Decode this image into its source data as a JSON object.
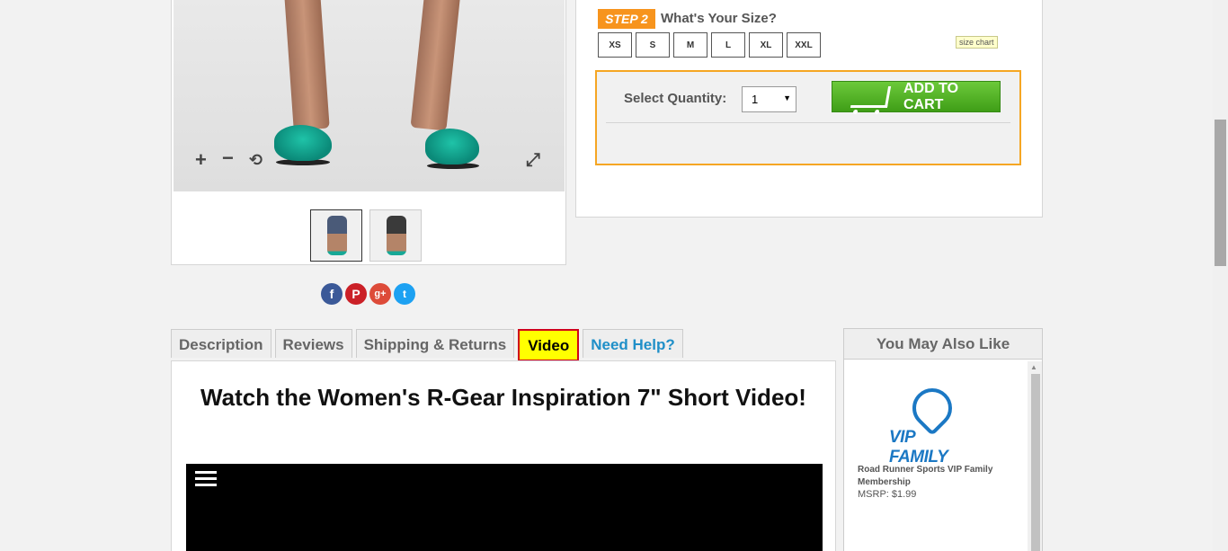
{
  "image_controls": {
    "zoom_in": "+",
    "zoom_out": "−",
    "reset": "⟲",
    "fullscreen": "⤢"
  },
  "social": {
    "facebook": "f",
    "pinterest": "P",
    "google_plus": "g+",
    "twitter": "t"
  },
  "size_step": {
    "badge": "STEP 2",
    "title": "What's Your Size?",
    "sizes": [
      "XS",
      "S",
      "M",
      "L",
      "XL",
      "XXL"
    ],
    "size_chart_label": "size chart"
  },
  "cart": {
    "quantity_label": "Select Quantity:",
    "quantity_value": "1",
    "add_to_cart_label": "ADD TO CART"
  },
  "tabs": [
    {
      "label": "Description"
    },
    {
      "label": "Reviews"
    },
    {
      "label": "Shipping & Returns"
    },
    {
      "label": "Video",
      "active": true
    },
    {
      "label": "Need Help?"
    }
  ],
  "video": {
    "title": "Watch the Women's R-Gear Inspiration 7\" Short Video!"
  },
  "also_like": {
    "title": "You May Also Like",
    "logo_text": "VIP FAMILY",
    "product_name": "Road Runner Sports VIP Family Membership",
    "price": "MSRP:  $1.99"
  },
  "colors": {
    "accent_orange": "#f7941d",
    "cart_green": "#4cb021",
    "active_tab": "#ffff00",
    "active_tab_border": "#d0021b",
    "help_link": "#1f8fc8",
    "vip_blue": "#1b78c4"
  }
}
